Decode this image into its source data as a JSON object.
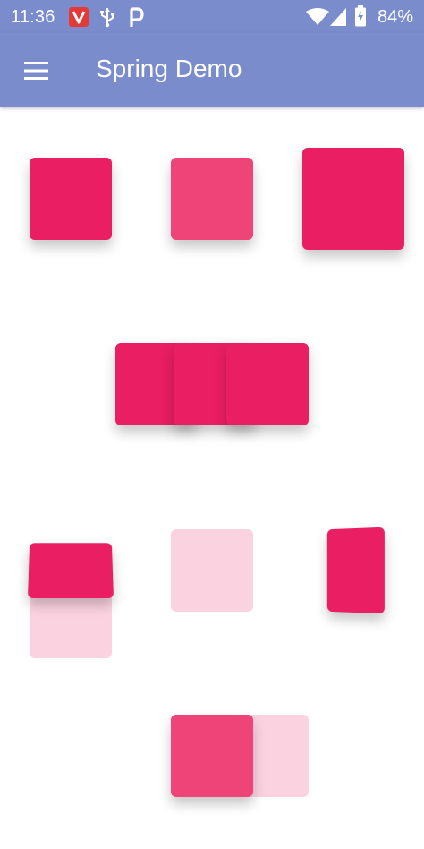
{
  "status_bar": {
    "time": "11:36",
    "battery": "84%",
    "icons": [
      "vivaldi-app-icon",
      "usb-icon",
      "parking-app-icon",
      "wifi-icon",
      "cell-signal-icon",
      "battery-icon"
    ]
  },
  "app_bar": {
    "title": "Spring Demo",
    "menu_icon": "hamburger-menu-icon",
    "color": "#7a8ccc"
  },
  "colors": {
    "accent": "#e91e63",
    "accent_mid": "#ee4478",
    "accent_light": "#fbd3e0"
  }
}
